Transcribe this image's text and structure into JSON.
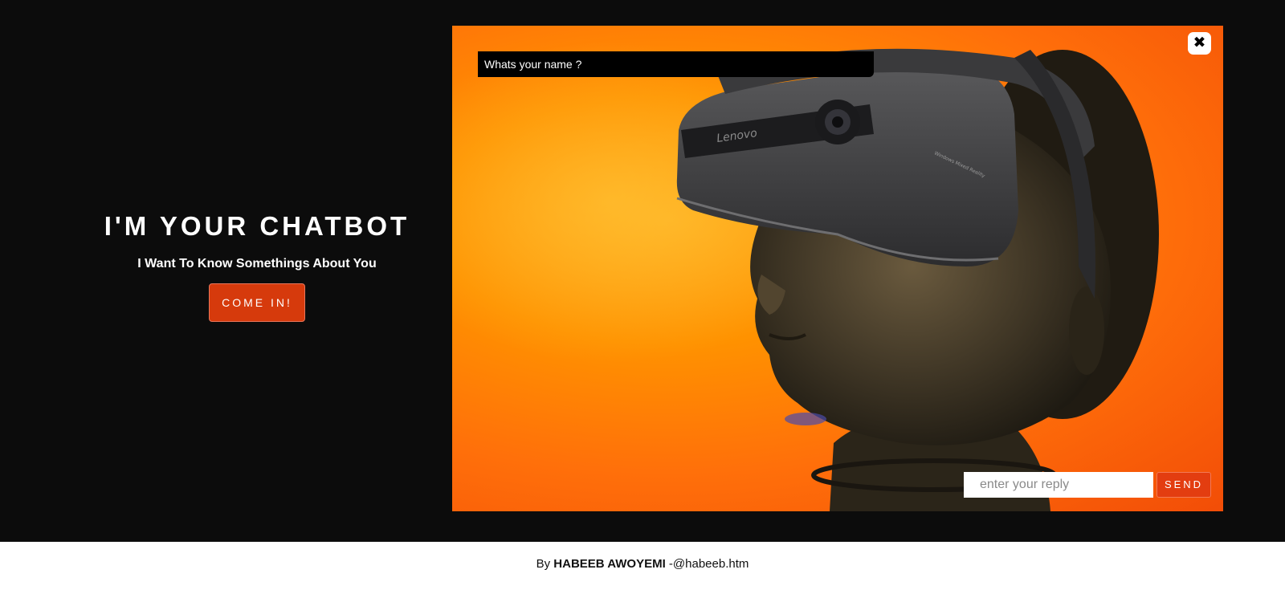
{
  "intro": {
    "title": "I'M YOUR CHATBOT",
    "subtitle": "I Want To Know Somethings About You",
    "button_label": "COME IN!"
  },
  "chat": {
    "question": "Whats your name ?",
    "close_icon": "close-icon",
    "close_glyph": "✖",
    "reply_placeholder": "enter your reply",
    "reply_value": "",
    "send_label": "SEND",
    "background_image": "VR headset on mannequin head",
    "headset_brand": "Lenovo",
    "headset_sub": "Windows Mixed Reality"
  },
  "footer": {
    "prefix": "By ",
    "author": "HABEEB AWOYEMI",
    "handle": " -@habeeb.htm"
  },
  "colors": {
    "page_bg": "#0c0c0c",
    "accent": "#d63a0c",
    "footer_bg": "#ffffff",
    "panel_orange": "#ff9200"
  }
}
